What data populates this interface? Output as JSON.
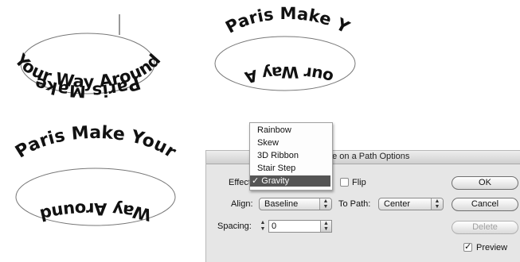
{
  "samples": {
    "top_left": {
      "top_text": "Paris Make",
      "bottom_text": "Your Way Around"
    },
    "top_right": {
      "top_text": "Paris Make Y",
      "bottom_text": "our Way A"
    },
    "bottom_left": {
      "top_text": "Paris Make Your",
      "bottom_text": "Way Around"
    }
  },
  "dialog": {
    "title": "pe on a Path Options",
    "effect_label": "Effect",
    "flip_label": "Flip",
    "flip_checked": false,
    "align_label": "Align:",
    "align_value": "Baseline",
    "to_path_label": "To Path:",
    "to_path_value": "Center",
    "spacing_label": "Spacing:",
    "spacing_value": "0",
    "ok_label": "OK",
    "cancel_label": "Cancel",
    "delete_label": "Delete",
    "preview_label": "Preview",
    "preview_checked": true
  },
  "effect_menu": {
    "items": [
      "Rainbow",
      "Skew",
      "3D Ribbon",
      "Stair Step",
      "Gravity"
    ],
    "selected": "Gravity",
    "check_glyph": "✓"
  }
}
